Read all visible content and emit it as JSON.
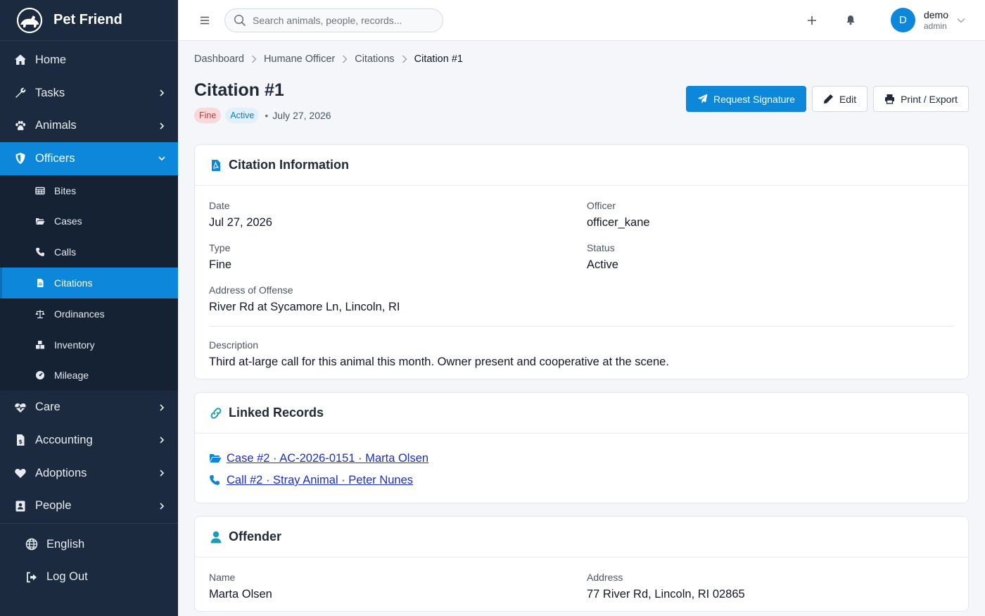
{
  "brand": {
    "name": "Pet Friend"
  },
  "colors": {
    "sidebar": "#1b2a3e",
    "accent": "#0d87d9",
    "badge_fine": "#f9d9da",
    "badge_active": "#e1f1fb",
    "link": "#1a2fc9"
  },
  "nav": {
    "home": "Home",
    "tasks": "Tasks",
    "animals": "Animals",
    "officers": "Officers",
    "officers_sub": [
      "Bites",
      "Cases",
      "Calls",
      "Citations",
      "Ordinances",
      "Inventory",
      "Mileage"
    ],
    "care": "Care",
    "accounting": "Accounting",
    "adoptions": "Adoptions",
    "people": "People",
    "language": "English",
    "logout": "Log Out"
  },
  "topbar": {
    "search_placeholder": "Search animals, people, records...",
    "user_initial": "D",
    "user_name": "demo",
    "user_role": "admin"
  },
  "breadcrumb": [
    "Dashboard",
    "Humane Officer",
    "Citations",
    "Citation #1"
  ],
  "page": {
    "title": "Citation #1",
    "badge_type": "Fine",
    "badge_status": "Active",
    "date": "July 27, 2026",
    "actions": {
      "request_signature": "Request Signature",
      "edit": "Edit",
      "print": "Print / Export"
    }
  },
  "citation": {
    "heading": "Citation Information",
    "date_label": "Date",
    "date_value": "Jul 27, 2026",
    "officer_label": "Officer",
    "officer_value": "officer_kane",
    "type_label": "Type",
    "type_value": "Fine",
    "status_label": "Status",
    "status_value": "Active",
    "address_label": "Address of Offense",
    "address_value": "River Rd at Sycamore Ln, Lincoln, RI",
    "description_label": "Description",
    "description_value": "Third at-large call for this animal this month. Owner present and cooperative at the scene."
  },
  "linked": {
    "heading": "Linked Records",
    "case_link": "Case #2 · AC-2026-0151 · Marta Olsen",
    "call_link": "Call #2 · Stray Animal · Peter Nunes"
  },
  "offender": {
    "heading": "Offender",
    "name_label": "Name",
    "name_value": "Marta Olsen",
    "address_label": "Address",
    "address_value": "77 River Rd, Lincoln, RI 02865"
  }
}
